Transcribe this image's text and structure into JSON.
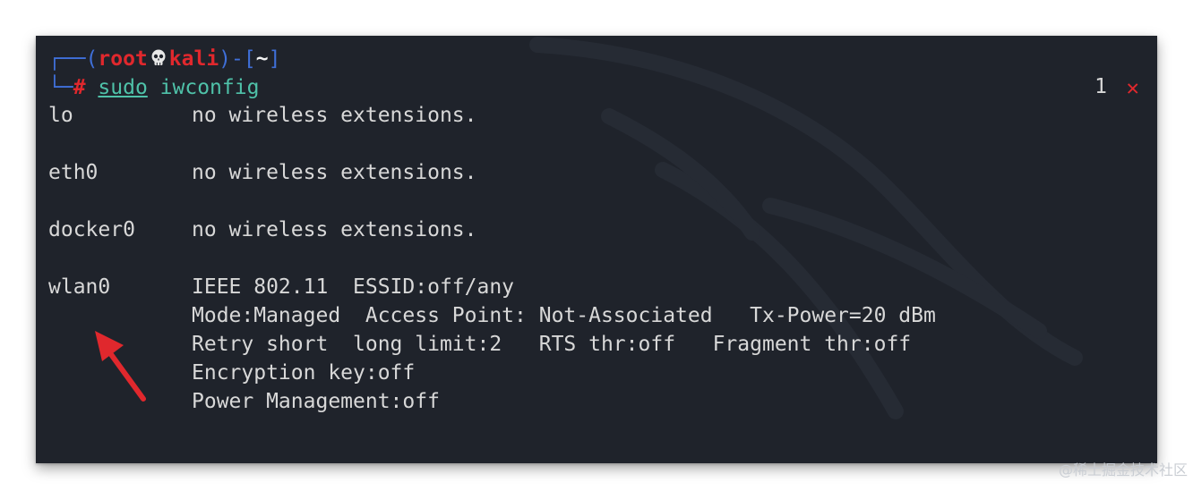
{
  "prompt": {
    "frame_open": "┌──(",
    "user": "root",
    "skull_icon": "skull-icon",
    "host": "kali",
    "frame_mid": ")-[",
    "cwd": "~",
    "frame_close": "]",
    "line2_prefix": "└─",
    "hash": "#",
    "cmd_sudo": "sudo",
    "cmd_arg": "iwconfig",
    "exit_code": "1",
    "exit_icon": "✕"
  },
  "output": [
    {
      "iface": "lo",
      "lines": [
        "no wireless extensions."
      ]
    },
    {
      "iface": "eth0",
      "lines": [
        "no wireless extensions."
      ]
    },
    {
      "iface": "docker0",
      "lines": [
        "no wireless extensions."
      ]
    },
    {
      "iface": "wlan0",
      "lines": [
        "IEEE 802.11  ESSID:off/any",
        "Mode:Managed  Access Point: Not-Associated   Tx-Power=20 dBm",
        "Retry short  long limit:2   RTS thr:off   Fragment thr:off",
        "Encryption key:off",
        "Power Management:off"
      ]
    }
  ],
  "annotation": {
    "arrow_icon": "red-arrow-icon",
    "color": "#e0282d"
  },
  "watermark": "@稀土掘金技术社区",
  "colors": {
    "terminal_bg": "#1f232b",
    "prompt_red": "#e0282d",
    "frame_blue": "#3f6fd8",
    "cmd_teal": "#4fc2a9"
  }
}
